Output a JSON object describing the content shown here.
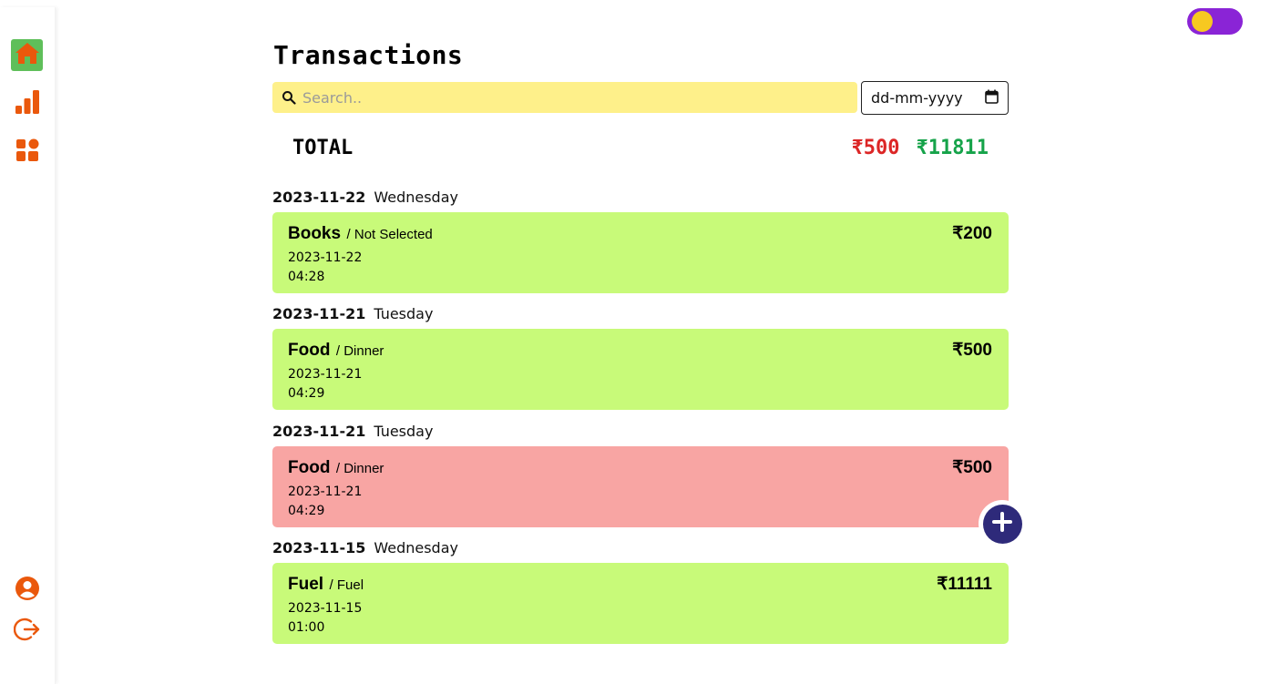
{
  "sidebar": {
    "items": [
      {
        "name": "home",
        "icon": "home-icon"
      },
      {
        "name": "stats",
        "icon": "bar-chart-icon"
      },
      {
        "name": "apps",
        "icon": "grid-icon"
      }
    ],
    "bottom": [
      {
        "name": "profile",
        "icon": "user-circle-icon"
      },
      {
        "name": "logout",
        "icon": "logout-icon"
      }
    ],
    "accent_color": "#ea580c",
    "active_bg": "#5fbf5a"
  },
  "theme_toggle": {
    "state": "light",
    "track_color": "#8a24d6",
    "knob_color": "#f7c821"
  },
  "page_title": "Transactions",
  "search": {
    "placeholder": "Search.."
  },
  "date_filter": {
    "placeholder": "dd-mm-yyyy"
  },
  "total": {
    "label": "TOTAL",
    "expense": "₹500",
    "income": "₹11811",
    "expense_color": "#dc2626",
    "income_color": "#16a34a"
  },
  "groups": [
    {
      "date": "2023-11-22",
      "day": "Wednesday",
      "txn": {
        "category": "Books",
        "sub": "/ Not Selected",
        "amount": "₹200",
        "date": "2023-11-22",
        "time": "04:28",
        "type": "income"
      }
    },
    {
      "date": "2023-11-21",
      "day": "Tuesday",
      "txn": {
        "category": "Food",
        "sub": "/ Dinner",
        "amount": "₹500",
        "date": "2023-11-21",
        "time": "04:29",
        "type": "income"
      }
    },
    {
      "date": "2023-11-21",
      "day": "Tuesday",
      "txn": {
        "category": "Food",
        "sub": "/ Dinner",
        "amount": "₹500",
        "date": "2023-11-21",
        "time": "04:29",
        "type": "expense"
      }
    },
    {
      "date": "2023-11-15",
      "day": "Wednesday",
      "txn": {
        "category": "Fuel",
        "sub": "/ Fuel",
        "amount": "₹11111",
        "date": "2023-11-15",
        "time": "01:00",
        "type": "income"
      }
    }
  ],
  "colors": {
    "income_card": "#c8fa79",
    "expense_card": "#f8a5a3",
    "fab": "#2e2a7a",
    "search_bg": "#fef08a"
  },
  "fab": {
    "icon": "plus-icon"
  }
}
